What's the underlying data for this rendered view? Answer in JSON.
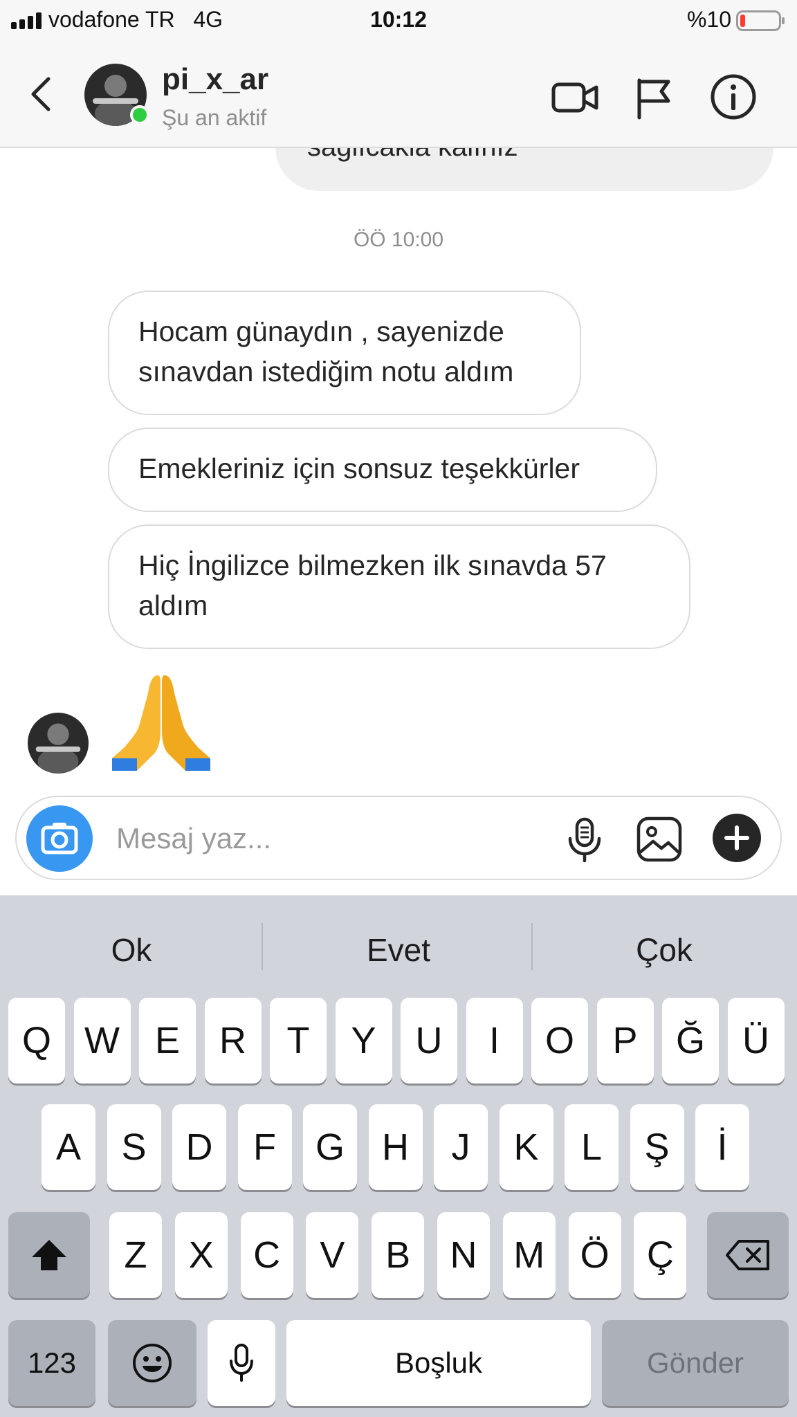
{
  "status_bar": {
    "carrier": "vodafone TR",
    "network": "4G",
    "time": "10:12",
    "battery": "%10",
    "battery_color": "#ff3b30"
  },
  "header": {
    "username": "pi_x_ar",
    "status": "Şu an aktif",
    "online_color": "#2ecc40"
  },
  "messages": {
    "previous_partial": "sağlıcakla kalınız",
    "timestamp": "ÖÖ 10:00",
    "items": [
      {
        "line1": "Hocam günaydın , sayenizde",
        "line2": "sınavdan istediğim notu aldım"
      },
      {
        "line1": "Emekleriniz için sonsuz teşekkürler",
        "line2": ""
      },
      {
        "line1": "Hiç İngilizce bilmezken ilk sınavda 57",
        "line2": "aldım"
      }
    ],
    "emoji": "folded-hands-emoji"
  },
  "composer": {
    "placeholder": "Mesaj yaz...",
    "value": "",
    "accent": "#3897f0"
  },
  "keyboard": {
    "suggestions": [
      "Ok",
      "Evet",
      "Çok"
    ],
    "row1": [
      "Q",
      "W",
      "E",
      "R",
      "T",
      "Y",
      "U",
      "I",
      "O",
      "P",
      "Ğ",
      "Ü"
    ],
    "row2": [
      "A",
      "S",
      "D",
      "F",
      "G",
      "H",
      "J",
      "K",
      "L",
      "Ş",
      "İ"
    ],
    "row3": [
      "Z",
      "X",
      "C",
      "V",
      "B",
      "N",
      "M",
      "Ö",
      "Ç"
    ],
    "numbers": "123",
    "space": "Boşluk",
    "send": "Gönder"
  }
}
